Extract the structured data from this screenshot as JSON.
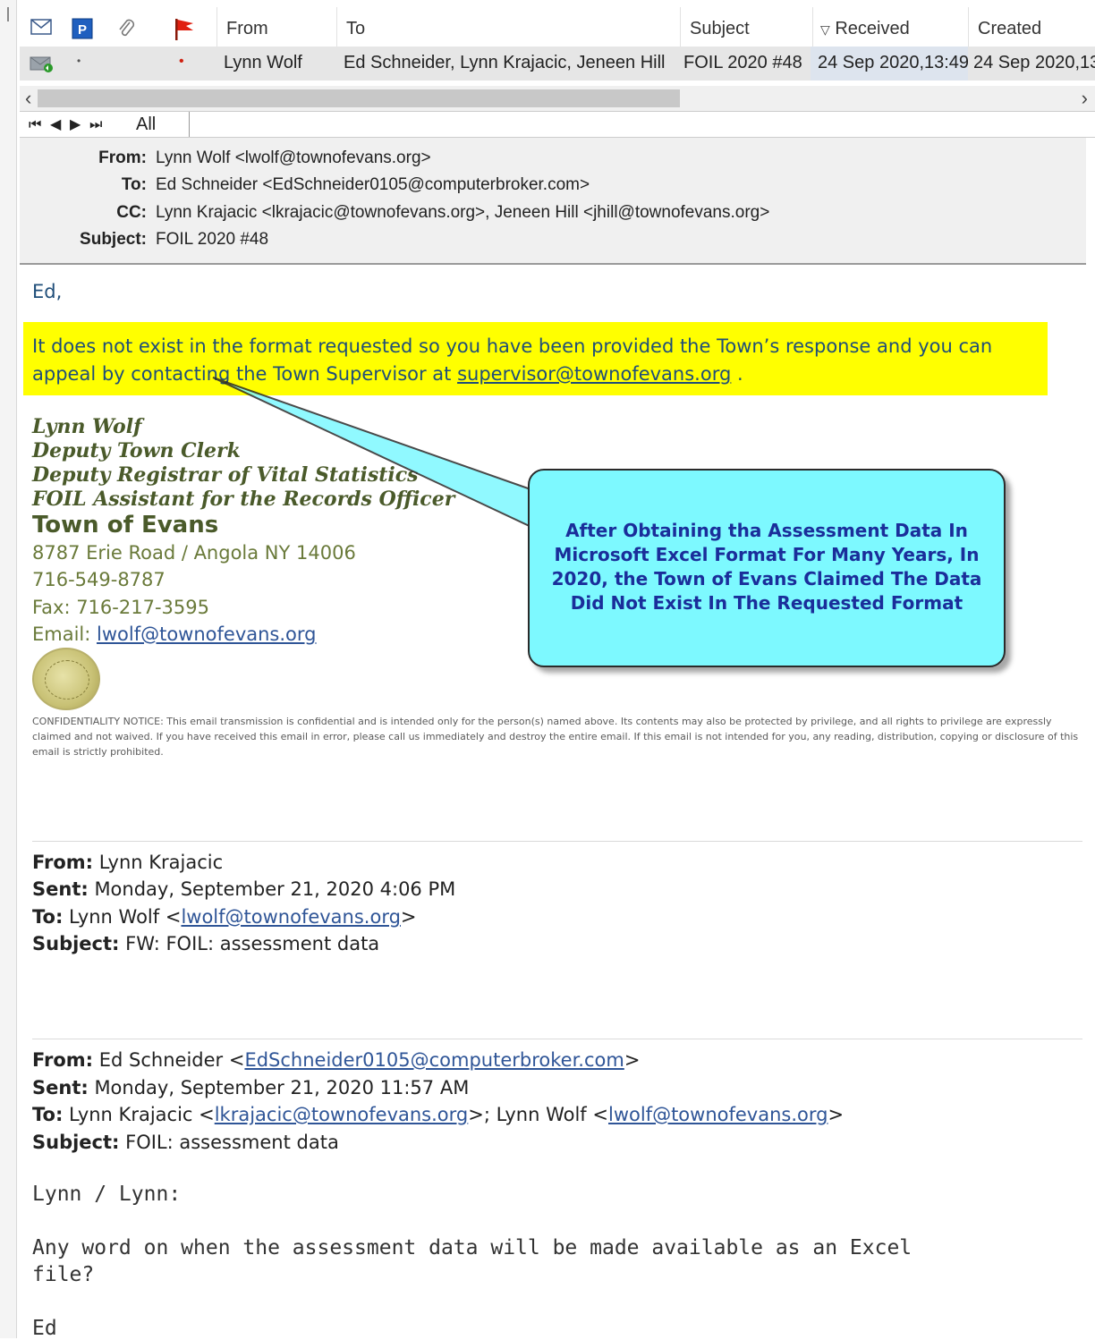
{
  "columns": {
    "from": "From",
    "to": "To",
    "subject": "Subject",
    "received": "Received",
    "created": "Created"
  },
  "message_row": {
    "from": "Lynn Wolf",
    "to": "Ed Schneider, Lynn Krajacic, Jeneen Hill",
    "subject": "FOIL 2020 #48",
    "received": "24 Sep 2020,13:49",
    "created": "24 Sep 2020,13"
  },
  "nav": {
    "tab_all": "All",
    "first": "⏮",
    "prev": "◀",
    "next": "▶",
    "last": "⏭"
  },
  "header": {
    "from_label": "From:",
    "from_value": "Lynn Wolf <lwolf@townofevans.org>",
    "to_label": "To:",
    "to_value": "Ed Schneider <EdSchneider0105@computerbroker.com>",
    "cc_label": "CC:",
    "cc_value": "Lynn Krajacic <lkrajacic@townofevans.org>, Jeneen Hill <jhill@townofevans.org>",
    "subject_label": "Subject:",
    "subject_value": "FOIL 2020 #48"
  },
  "body": {
    "greeting": "Ed,",
    "highlight_text": "It does not exist in the format requested so you have been provided the Town’s response and you can appeal by contacting the Town Supervisor at ",
    "highlight_link": "supervisor@townofevans.org",
    "highlight_end": " ."
  },
  "signature": {
    "name": "Lynn Wolf",
    "title1": "Deputy Town Clerk",
    "title2": "Deputy Registrar of Vital Statistics",
    "title3": "FOIL Assistant for the Records Officer",
    "town": "Town of Evans",
    "address": "8787 Erie Road / Angola NY 14006",
    "phone": "716-549-8787",
    "fax": "Fax: 716-217-3595",
    "email_label": "Email: ",
    "email": "lwolf@townofevans.org"
  },
  "confidentiality": "CONFIDENTIALITY NOTICE: This email transmission is confidential and is intended only for the person(s) named above. Its contents may also be protected by privilege, and all rights to privilege are expressly claimed and not waived. If you have received this email in error, please call us immediately and destroy the entire email. If this email is not intended for you, any reading, distribution, copying or disclosure of this email is strictly prohibited.",
  "callout": "After Obtaining tha Assessment Data In Microsoft Excel Format For Many Years, In 2020,  the Town of Evans Claimed The Data Did Not Exist In The Requested Format",
  "fw1": {
    "from_label": "From:",
    "from_value": " Lynn Krajacic",
    "sent_label": "Sent:",
    "sent_value": " Monday, September 21, 2020 4:06 PM",
    "to_label": "To:",
    "to_value": " Lynn Wolf <",
    "to_link": "lwolf@townofevans.org",
    "to_end": ">",
    "subject_label": "Subject:",
    "subject_value": " FW: FOIL: assessment data"
  },
  "fw2": {
    "from_label": "From:",
    "from_value": " Ed Schneider <",
    "from_link": "EdSchneider0105@computerbroker.com",
    "from_end": ">",
    "sent_label": "Sent:",
    "sent_value": " Monday, September 21, 2020 11:57 AM",
    "to_label": "To:",
    "to_value": " Lynn Krajacic <",
    "to_link1": "lkrajacic@townofevans.org",
    "to_mid": ">; Lynn Wolf <",
    "to_link2": "lwolf@townofevans.org",
    "to_end": ">",
    "subject_label": "Subject:",
    "subject_value": " FOIL: assessment data"
  },
  "original": {
    "greeting": "Lynn / Lynn:",
    "line1": "Any word on when the assessment data will be made available as an Excel",
    "line2": "file?",
    "signoff": "Ed"
  },
  "colors": {
    "highlight": "#ffff00",
    "callout": "#7df9ff",
    "callout_text": "#1a2e9a",
    "sig": "#4a5a2a"
  }
}
